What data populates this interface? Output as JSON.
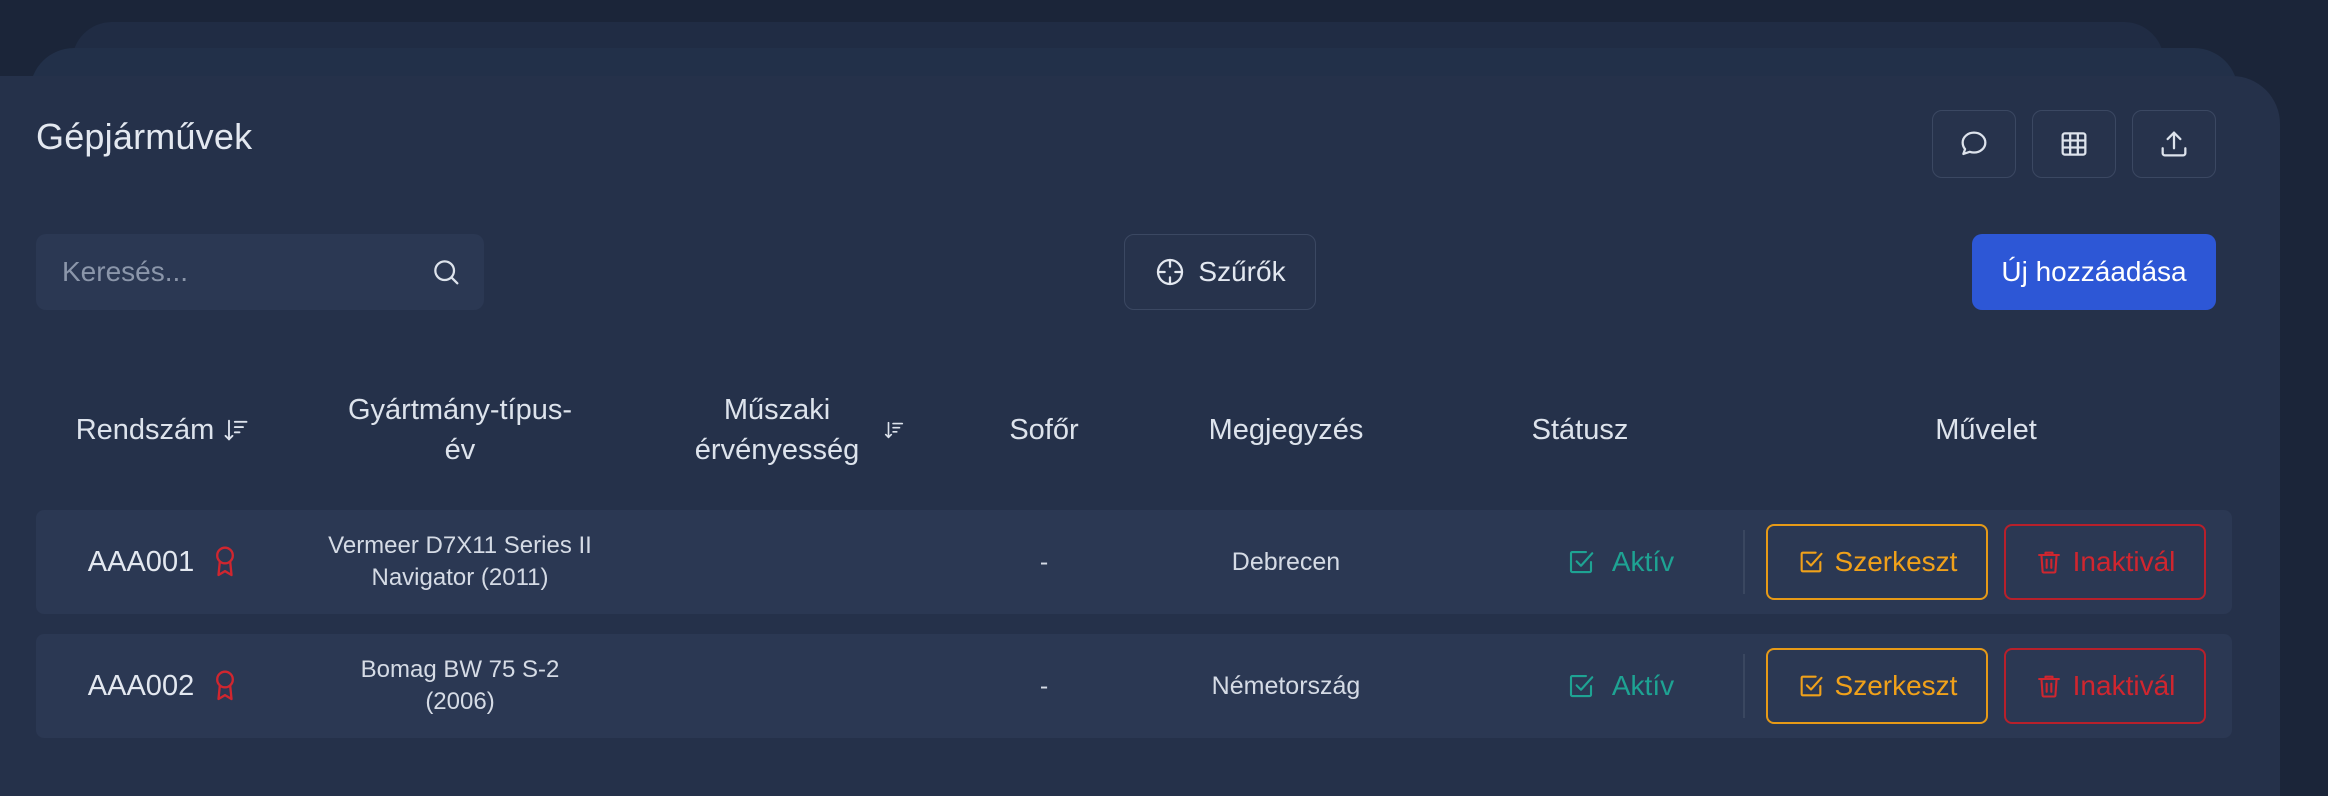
{
  "page": {
    "title": "Gépjárművek"
  },
  "toolbar": {
    "comment_icon": "comment-icon",
    "table_icon": "table-icon",
    "export_icon": "upload-icon"
  },
  "search": {
    "placeholder": "Keresés..."
  },
  "filters": {
    "label": "Szűrők"
  },
  "add": {
    "label": "Új hozzáadása"
  },
  "colors": {
    "primary": "#2d57d6",
    "active": "#1ea393",
    "edit": "#f0a11a",
    "danger": "#d0262f"
  },
  "table": {
    "headers": {
      "plate": "Rendszám",
      "model_line1": "Gyártmány-típus-",
      "model_line2": "év",
      "inspection_line1": "Műszaki",
      "inspection_line2": "érvényesség",
      "driver": "Sofőr",
      "note": "Megjegyzés",
      "status": "Státusz",
      "action": "Művelet"
    },
    "rows": [
      {
        "plate": "AAA001",
        "model_line1": "Vermeer D7X11 Series II",
        "model_line2": "Navigator (2011)",
        "inspection": "",
        "driver": "-",
        "note": "Debrecen",
        "status": "Aktív",
        "edit": "Szerkeszt",
        "deactivate": "Inaktivál"
      },
      {
        "plate": "AAA002",
        "model_line1": "Bomag BW 75 S-2",
        "model_line2": "(2006)",
        "inspection": "",
        "driver": "-",
        "note": "Németország",
        "status": "Aktív",
        "edit": "Szerkeszt",
        "deactivate": "Inaktivál"
      }
    ]
  }
}
